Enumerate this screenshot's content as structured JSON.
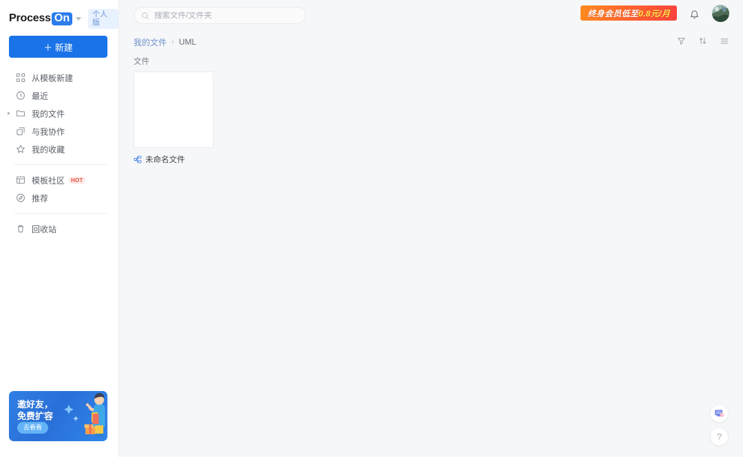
{
  "brand": {
    "name_part1": "Process",
    "name_part2": "On",
    "edition_badge": "个人版",
    "caret_icon": "chevron-down-icon"
  },
  "sidebar": {
    "new_button": "＋ 新建",
    "items": [
      {
        "label": "从模板新建",
        "icon": "template-grid-icon",
        "badge": null,
        "expandable": false
      },
      {
        "label": "最近",
        "icon": "clock-icon",
        "badge": null,
        "expandable": false
      },
      {
        "label": "我的文件",
        "icon": "folder-icon",
        "badge": null,
        "expandable": true
      },
      {
        "label": "与我协作",
        "icon": "share-icon",
        "badge": null,
        "expandable": false
      },
      {
        "label": "我的收藏",
        "icon": "star-icon",
        "badge": null,
        "expandable": false
      },
      {
        "label": "模板社区",
        "icon": "community-icon",
        "badge": "HOT",
        "expandable": false
      },
      {
        "label": "推荐",
        "icon": "compass-icon",
        "badge": null,
        "expandable": false
      },
      {
        "label": "回收站",
        "icon": "trash-icon",
        "badge": null,
        "expandable": false
      }
    ],
    "separator_after": [
      4,
      6
    ],
    "promo": {
      "line1": "邀好友，",
      "line2": "免费扩容",
      "button": "去看看"
    }
  },
  "topbar": {
    "search": {
      "placeholder": "搜索文件/文件夹",
      "value": "",
      "icon": "search-icon"
    },
    "member_banner": {
      "text_white": "终身会员低至",
      "text_yellow": "0.8元/月"
    },
    "bell_icon": "bell-icon",
    "avatar_icon": "user-avatar"
  },
  "content": {
    "breadcrumb": [
      {
        "label": "我的文件",
        "current": false
      },
      {
        "label": "UML",
        "current": true
      }
    ],
    "breadcrumb_separator": "›",
    "section_label": "文件",
    "toolbar": [
      {
        "name": "filter-icon",
        "title": "筛选"
      },
      {
        "name": "sort-icon",
        "title": "排序"
      },
      {
        "name": "list-view-icon",
        "title": "视图"
      }
    ],
    "files": [
      {
        "name": "未命名文件",
        "type_icon": "flowchart-icon"
      }
    ]
  },
  "floating": {
    "feedback_icon": "feedback-monitor-icon",
    "help_label": "?"
  },
  "colors": {
    "accent": "#1a73e8",
    "logo_badge": "#2b7cec",
    "breadcrumb_link": "#6e93cc",
    "hot_badge_bg": "#fdeceb",
    "hot_badge_text": "#e8513f",
    "banner_gradient_from": "#ff8a1f",
    "banner_gradient_to": "#f8443f",
    "banner_highlight": "#ffe94a",
    "page_bg": "#f6f7f9"
  }
}
